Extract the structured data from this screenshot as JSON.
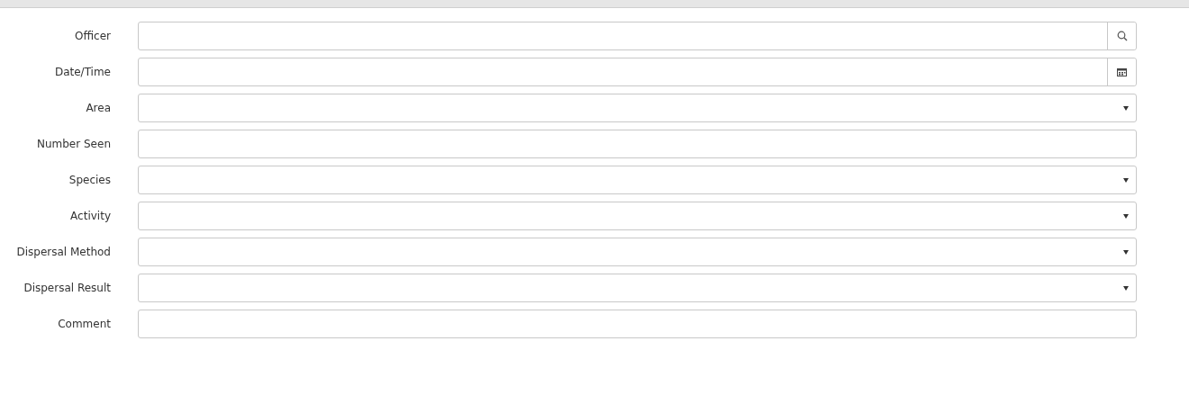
{
  "fields": [
    {
      "label": "Officer",
      "kind": "lookup"
    },
    {
      "label": "Date/Time",
      "kind": "date"
    },
    {
      "label": "Area",
      "kind": "select"
    },
    {
      "label": "Number Seen",
      "kind": "text"
    },
    {
      "label": "Species",
      "kind": "select"
    },
    {
      "label": "Activity",
      "kind": "select"
    },
    {
      "label": "Dispersal Method",
      "kind": "select"
    },
    {
      "label": "Dispersal Result",
      "kind": "select"
    },
    {
      "label": "Comment",
      "kind": "text"
    }
  ]
}
